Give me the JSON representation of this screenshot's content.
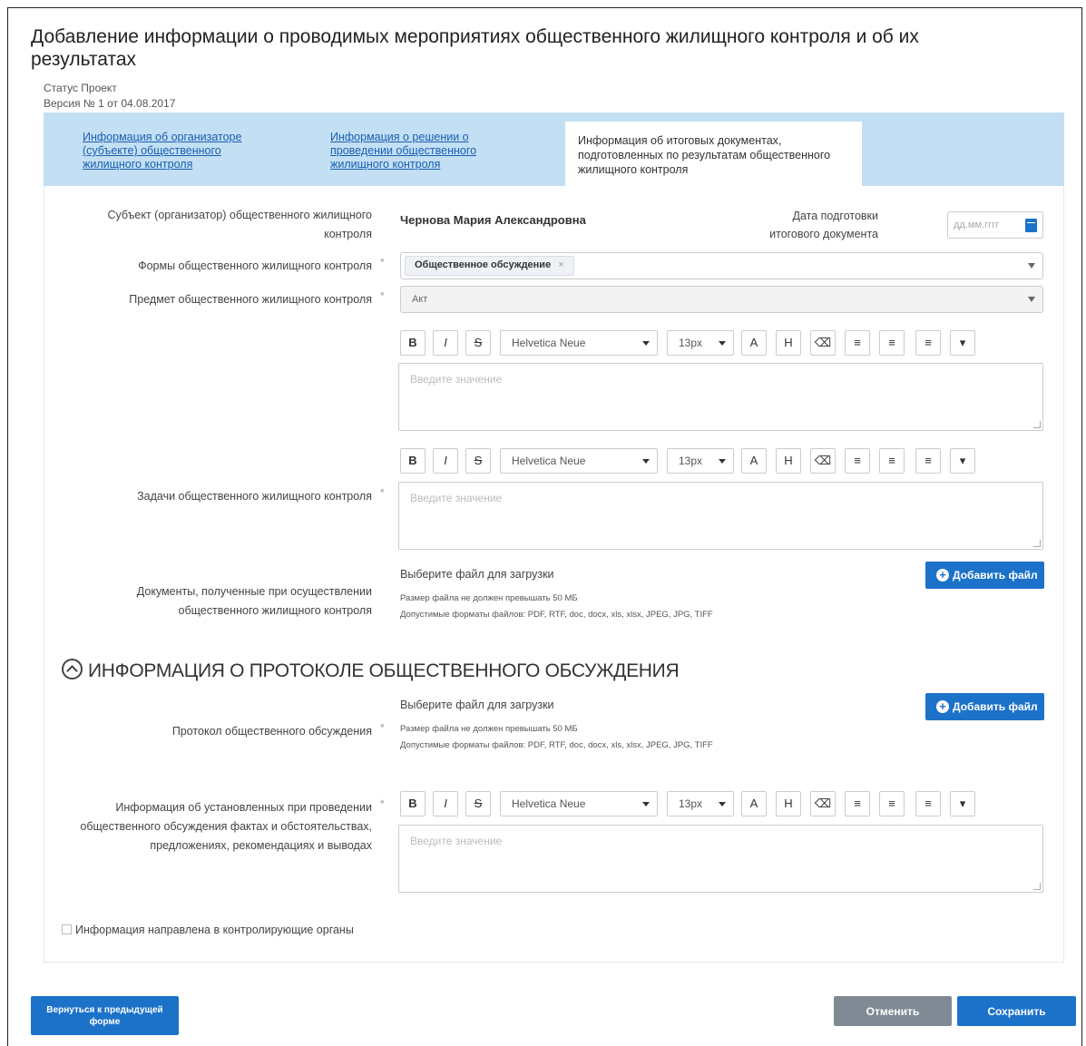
{
  "page": {
    "title": "Добавление информации о проводимых мероприятиях общественного жилищного контроля и об их результатах",
    "status": "Статус Проект",
    "version": "Версия № 1 от 04.08.2017"
  },
  "tabs": [
    {
      "label": "Информация об организаторе (субъекте) общественного жилищного контроля",
      "active": false
    },
    {
      "label": "Информация о решении о проведении общественного жилищного контроля",
      "active": false
    },
    {
      "label": "Информация об итоговых документах, подготовленных по результатам общественного жилищного контроля",
      "active": true
    }
  ],
  "form": {
    "subject_label": "Субъект (организатор) общественного жилищного контроля",
    "subject_value": "Чернова Мария Александровна",
    "date_label": "Дата подготовки итогового документа",
    "date_placeholder": "дд.мм.гггг",
    "forms_label": "Формы общественного жилищного контроля",
    "forms_chip": "Общественное обсуждение",
    "forms_chip_x": "×",
    "subject_control_label": "Предмет общественного жилищного контроля",
    "subject_control_value": "Акт",
    "tasks_label": "Задачи общественного жилищного контроля",
    "documents_label": "Документы, полученные при осуществлении общественного жилищного контроля",
    "required_mark": "*",
    "editor_placeholder": "Введите значение",
    "toolbar": {
      "bold": "B",
      "italic": "I",
      "strike": "S",
      "font": "Helvetica Neue",
      "size": "13px",
      "text_color": "A",
      "highlight": "H",
      "eraser": "⌫",
      "list_ul": "≡",
      "list_ol": "≡",
      "align": "≡",
      "more": "▾"
    },
    "upload_title": "Выберите файл для загрузки",
    "upload_size": "Размер файла не должен превышать 50 МБ",
    "upload_formats": "Допустимые форматы файлов: PDF, RTF, doc, docx, xls, xlsx, JPEG, JPG, TIFF",
    "add_file": "Добавить файл",
    "add_file_icon": "+"
  },
  "protocol": {
    "section_title": "ИНФОРМАЦИЯ О ПРОТОКОЛЕ ОБЩЕСТВЕННОГО ОБСУЖДЕНИЯ",
    "protocol_label": "Протокол общественного обсуждения",
    "facts_label": "Информация об установленных при проведении общественного обсуждения фактах и обстоятельствах, предложениях, рекомендациях и выводах",
    "checkbox_label": "Информация направлена в контролирующие органы"
  },
  "footer": {
    "back": "Вернуться к предыдущей форме",
    "cancel": "Отменить",
    "save": "Сохранить"
  },
  "colors": {
    "accent": "#1c72c9",
    "tab_bar": "#c3dff3",
    "cancel": "#808a94"
  }
}
